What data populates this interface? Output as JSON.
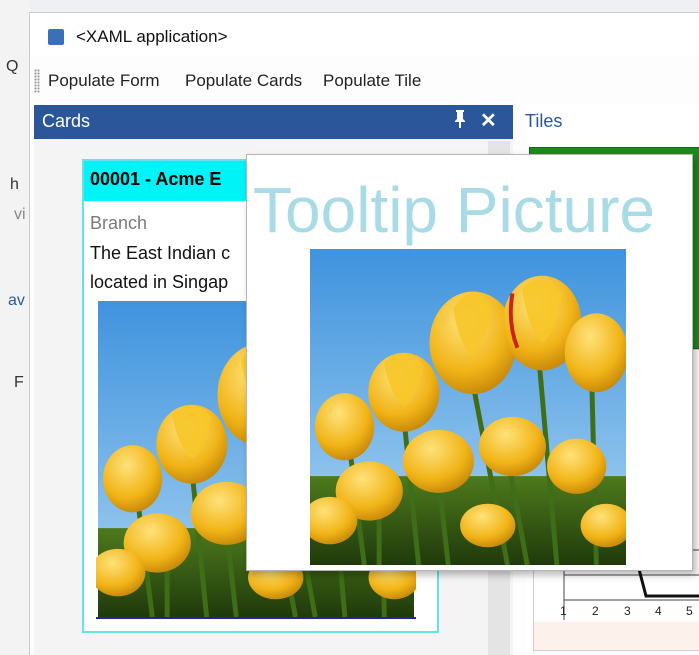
{
  "background_window": {
    "fragments": [
      "Q",
      "h",
      "vi",
      "av",
      "F"
    ]
  },
  "window": {
    "title": "<XAML application>"
  },
  "toolbar": {
    "buttons": [
      "Populate Form",
      "Populate Cards",
      "Populate Tile"
    ]
  },
  "cards_panel": {
    "title": "Cards",
    "pin_icon": "pin-icon",
    "close_icon": "close-icon",
    "card": {
      "id_text": "00001 - Acme E",
      "branch_label": "Branch",
      "description_line1": "The East Indian c",
      "description_line2": "located in Singap"
    }
  },
  "tiles_panel": {
    "title": "Tiles",
    "axis_ticks": [
      "1",
      "2",
      "3",
      "4",
      "5"
    ]
  },
  "tooltip": {
    "title": "Tooltip Picture"
  },
  "colors": {
    "panel_header": "#2b579a",
    "card_header": "#00f3f6",
    "tooltip_title": "#a9dbe6",
    "tile_green": "#1a8c1a"
  }
}
